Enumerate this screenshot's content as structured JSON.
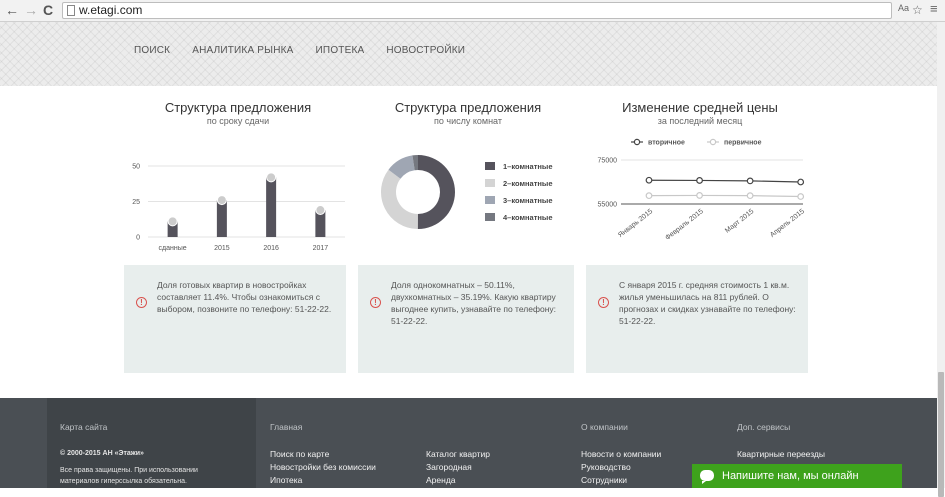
{
  "browser": {
    "url": "w.etagi.com",
    "back_glyph": "←",
    "forward_glyph": "→",
    "reload_glyph": "C",
    "translate_glyph": "Aa",
    "star_glyph": "☆",
    "menu_glyph": "≡"
  },
  "menu": [
    "ПОИСК",
    "АНАЛИТИКА РЫНКА",
    "ИПОТЕКА",
    "НОВОСТРОЙКИ"
  ],
  "sections": [
    {
      "title": "Структура предложения",
      "subtitle": "по сроку сдачи",
      "info": "Доля готовых квартир в новостройках составляет 11.4%. Чтобы ознакомиться с выбором, позвоните по телефону: 51-22-22."
    },
    {
      "title": "Структура предложения",
      "subtitle": "по числу комнат",
      "info": "Доля однокомнатных – 50.11%, двухкомнатных – 35.19%. Какую квартиру выгоднее купить, узнавайте по телефону: 51-22-22."
    },
    {
      "title": "Изменение средней цены",
      "subtitle": "за последний месяц",
      "info": "С января 2015 г. средняя стоимость 1 кв.м. жилья уменьшилась на 811 рублей. О прогнозах и скидках узнавайте по телефону: 51-22-22."
    }
  ],
  "info_icon_glyph": "!",
  "chart_data": [
    {
      "type": "bar",
      "categories": [
        "сданные",
        "2015",
        "2016",
        "2017"
      ],
      "values": [
        11,
        26,
        42,
        19
      ],
      "ylim": [
        0,
        50
      ],
      "yticks": [
        "0",
        "25",
        "50"
      ],
      "grid": true,
      "colors": {
        "bar": "#55535c",
        "dot": "#cccccc"
      }
    },
    {
      "type": "pie",
      "labels": [
        "1–комнатные",
        "2–комнатные",
        "3–комнатные",
        "4–комнатные"
      ],
      "values": [
        50.11,
        35.19,
        12.3,
        2.4
      ],
      "colors": [
        "#55535c",
        "#d4d4d4",
        "#9fa6b3",
        "#757880"
      ],
      "legend_position": "right"
    },
    {
      "type": "line",
      "x": [
        "Январь 2015",
        "Февраль 2015",
        "Март 2015",
        "Апрель 2015"
      ],
      "series": [
        {
          "name": "вторичное",
          "values": [
            65800,
            65700,
            65500,
            65000
          ],
          "color": "#444444"
        },
        {
          "name": "первичное",
          "values": [
            58800,
            58900,
            58800,
            58400
          ],
          "color": "#c8c8c8"
        }
      ],
      "ylim": [
        55000,
        75000
      ],
      "yticks": [
        "55000",
        "75000"
      ],
      "legend_position": "top",
      "grid": true
    }
  ],
  "footer": {
    "sitemap": "Карта сайта",
    "copyright": "© 2000-2015 АН «Этажи»",
    "rights": "Все права защищены. При использовании материалов гиперссылка обязательна.",
    "col_main": {
      "title": "Главная",
      "links_a": [
        "Поиск по карте",
        "Новостройки без комиссии",
        "Ипотека"
      ],
      "links_b": [
        "Каталог квартир",
        "Загородная",
        "Аренда"
      ]
    },
    "col_company": {
      "title": "О компании",
      "links": [
        "Новости о компании",
        "Руководство",
        "Сотрудники"
      ]
    },
    "col_services": {
      "title": "Доп. сервисы",
      "links": [
        "Квартирные переезды"
      ]
    }
  },
  "chat": {
    "label": "Напишите нам, мы онлайн"
  }
}
